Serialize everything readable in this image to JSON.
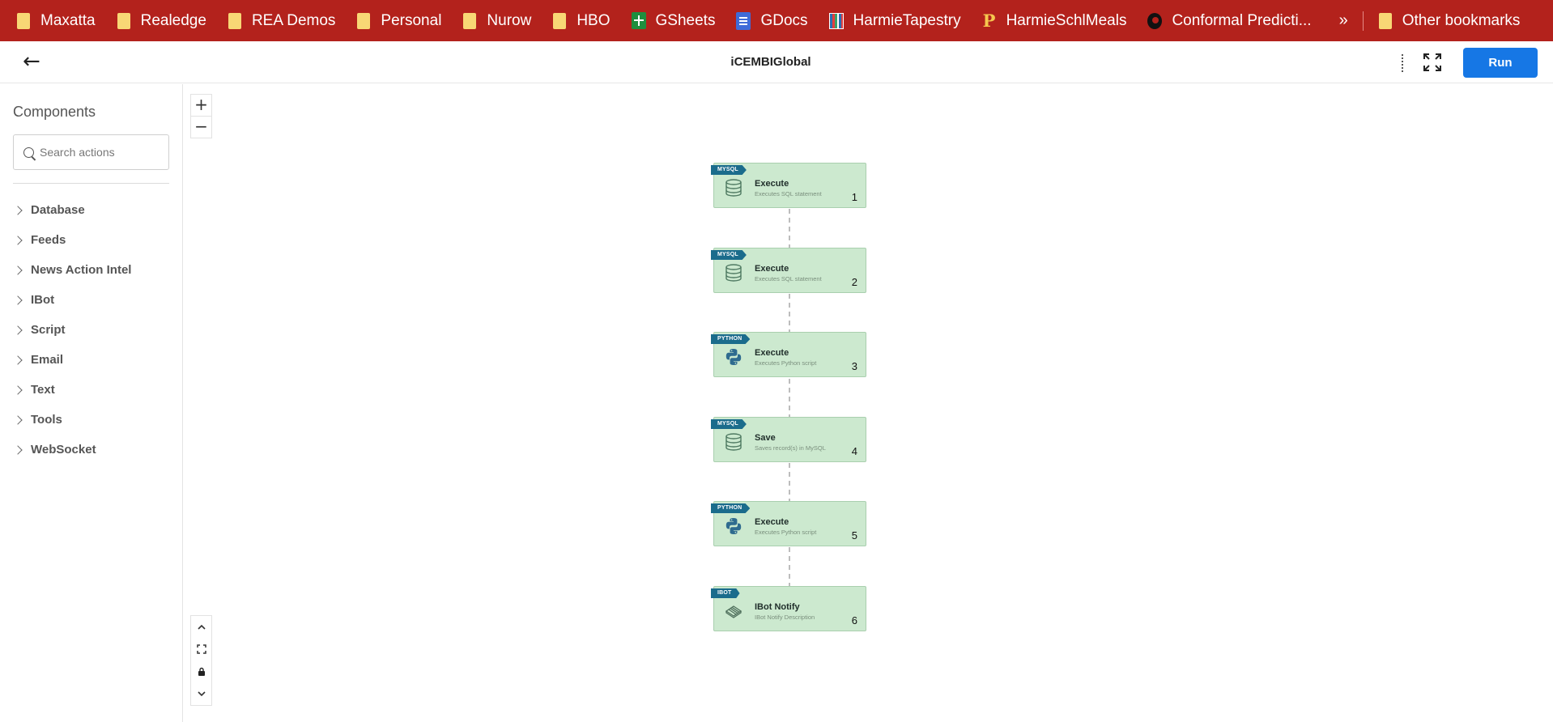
{
  "bookmarks": [
    {
      "label": "Maxatta",
      "icon": "folder-icon"
    },
    {
      "label": "Realedge",
      "icon": "folder-icon"
    },
    {
      "label": "REA Demos",
      "icon": "folder-icon"
    },
    {
      "label": "Personal",
      "icon": "folder-icon"
    },
    {
      "label": "Nurow",
      "icon": "folder-icon"
    },
    {
      "label": "HBO",
      "icon": "folder-icon"
    },
    {
      "label": "GSheets",
      "icon": "google-sheets-icon"
    },
    {
      "label": "GDocs",
      "icon": "google-docs-icon"
    },
    {
      "label": "HarmieTapestry",
      "icon": "tapestry-icon"
    },
    {
      "label": "HarmieSchlMeals",
      "icon": "p-logo-icon"
    },
    {
      "label": "Conformal Predicti...",
      "icon": "github-icon"
    }
  ],
  "bookmarks_more": "»",
  "other_bookmarks": "Other bookmarks",
  "header": {
    "title": "iCEMBIGlobal",
    "run_label": "Run",
    "back_glyph": "←"
  },
  "sidebar": {
    "title": "Components",
    "search_placeholder": "Search actions",
    "categories": [
      "Database",
      "Feeds",
      "News Action Intel",
      "IBot",
      "Script",
      "Email",
      "Text",
      "Tools",
      "WebSocket"
    ]
  },
  "canvas": {
    "zoom_in": "+",
    "zoom_out": "−",
    "nodes": [
      {
        "tag": "MYSQL",
        "icon": "database-icon",
        "title": "Execute",
        "desc": "Executes SQL statement",
        "num": "1"
      },
      {
        "tag": "MYSQL",
        "icon": "database-icon",
        "title": "Execute",
        "desc": "Executes SQL statement",
        "num": "2"
      },
      {
        "tag": "PYTHON",
        "icon": "python-icon",
        "title": "Execute",
        "desc": "Executes Python script",
        "num": "3"
      },
      {
        "tag": "MYSQL",
        "icon": "database-icon",
        "title": "Save",
        "desc": "Saves record(s) in MySQL",
        "num": "4"
      },
      {
        "tag": "PYTHON",
        "icon": "python-icon",
        "title": "Execute",
        "desc": "Executes Python script",
        "num": "5"
      },
      {
        "tag": "IBOT",
        "icon": "ibot-icon",
        "title": "IBot Notify",
        "desc": "IBot Notify Description",
        "num": "6"
      }
    ]
  },
  "colors": {
    "bookmark_bar": "#b3221c",
    "run_button": "#1677e5",
    "node_fill": "#cce9cf",
    "node_tag": "#1b6c8c"
  }
}
